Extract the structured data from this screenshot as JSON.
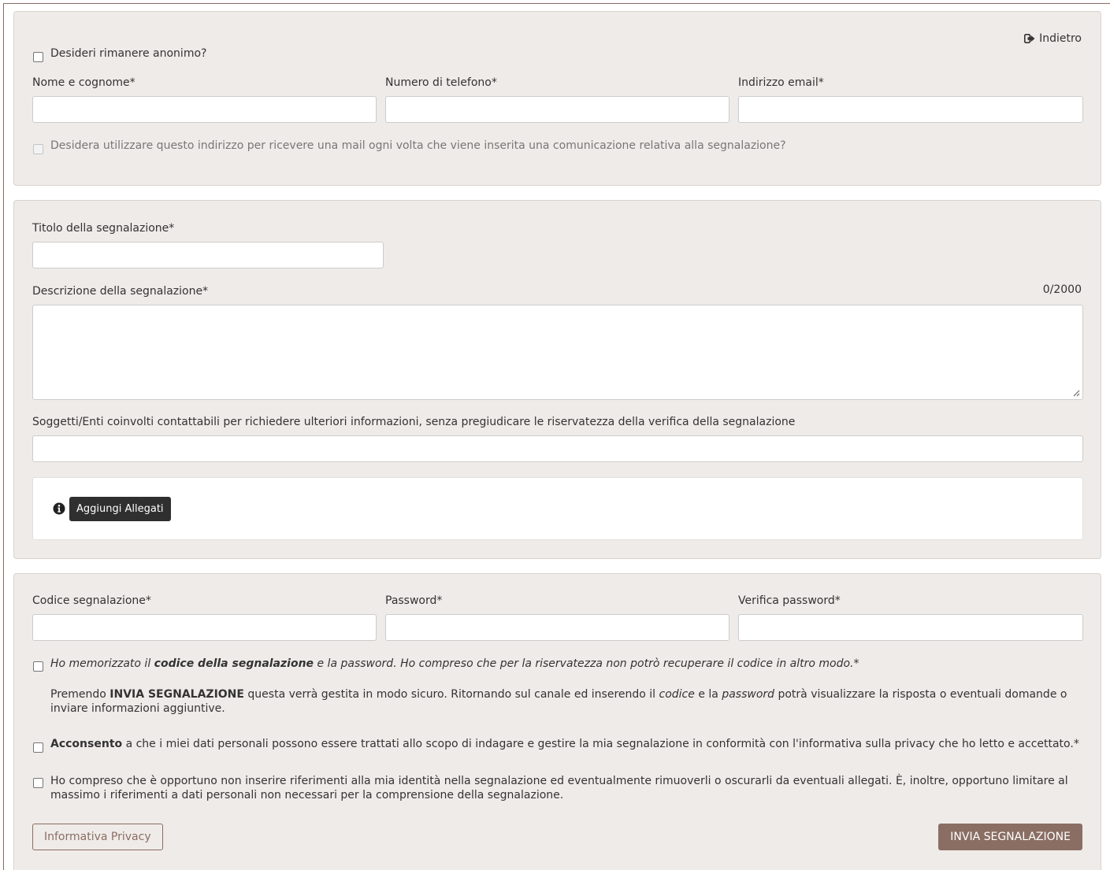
{
  "colors": {
    "panel_bg": "#efebe8",
    "accent": "#8a6e64",
    "dark_button": "#2f2f2f"
  },
  "identity": {
    "back_label": "Indietro",
    "back_icon": "sign-out-icon",
    "anonymous_label": "Desideri rimanere anonimo?",
    "name_label": "Nome e cognome*",
    "name_value": "",
    "phone_label": "Numero di telefono*",
    "phone_value": "",
    "email_label": "Indirizzo email*",
    "email_value": "",
    "email_notify_label": "Desidera utilizzare questo indirizzo per ricevere una mail ogni volta che viene inserita una comunicazione relativa alla segnalazione?"
  },
  "report": {
    "title_label": "Titolo della segnalazione*",
    "title_value": "",
    "description_label": "Descrizione della segnalazione*",
    "description_value": "",
    "char_counter": "0/2000",
    "subjects_label": "Soggetti/Enti coinvolti contattabili per richiedere ulteriori informazioni, senza pregiudicare le riservatezza della verifica della segnalazione",
    "subjects_value": "",
    "info_icon": "info-circle-icon",
    "attach_button": "Aggiungi Allegati"
  },
  "credentials": {
    "code_label": "Codice segnalazione*",
    "code_value": "",
    "password_label": "Password*",
    "password_value": "",
    "verify_label": "Verifica password*",
    "verify_value": "",
    "memorized": {
      "pre": "Ho memorizzato il ",
      "bold": "codice della segnalazione",
      "post": " e la password. Ho compreso che per la riservatezza non potrò recuperare il codice in altro modo.*"
    },
    "info_paragraph": {
      "pre": "Premendo ",
      "bold": "INVIA SEGNALAZIONE",
      "mid1": " questa verrà gestita in modo sicuro. Ritornando sul canale ed inserendo il ",
      "italic1": "codice",
      "mid2": " e la ",
      "italic2": "password",
      "post": " potrà visualizzare la risposta o eventuali domande o inviare informazioni aggiuntive."
    },
    "consent": {
      "bold": "Acconsento",
      "post": " a che i miei dati personali possono essere trattati allo scopo di indagare e gestire la mia segnalazione in conformità con l'informativa sulla privacy che ho letto e accettato.*"
    },
    "identity_notice": "Ho compreso che è opportuno non inserire riferimenti alla mia identità nella segnalazione ed eventualmente rimuoverli o oscurarli da eventuali allegati. È, inoltre, opportuno limitare al massimo i riferimenti a dati personali non necessari per la comprensione della segnalazione.",
    "privacy_button": "Informativa Privacy",
    "submit_button": "INVIA SEGNALAZIONE"
  }
}
